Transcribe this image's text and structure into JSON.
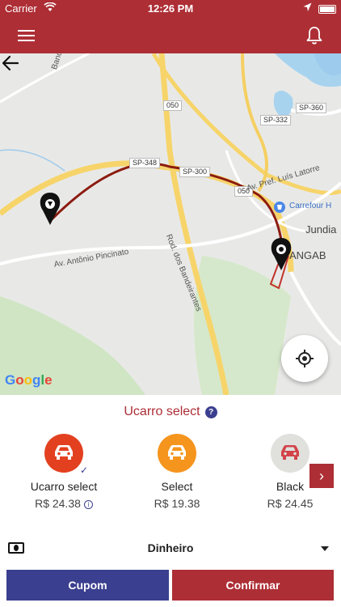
{
  "status_bar": {
    "carrier": "Carrier",
    "time": "12:26 PM"
  },
  "map": {
    "road_labels": [
      "050",
      "SP-360",
      "SP-332",
      "SP-348",
      "SP-300",
      "050"
    ],
    "street_labels": [
      "Bandeirantes",
      "Av. Antônio Pincinato",
      "Rod. dos Bandeirantes",
      "Av. Pref. Luís Latorre"
    ],
    "poi_label": "Carrefour H",
    "city_labels": [
      "Jundia",
      "ANGAB"
    ],
    "google": [
      "G",
      "o",
      "o",
      "g",
      "l",
      "e"
    ]
  },
  "selected_title": "Ucarro select",
  "help_icon": "?",
  "car_options": [
    {
      "name": "Ucarro select",
      "price": "R$ 24.38",
      "color": "#e3401f",
      "selected": true,
      "info": "i"
    },
    {
      "name": "Select",
      "price": "R$ 19.38",
      "color": "#f5951e",
      "selected": false
    },
    {
      "name": "Black",
      "price": "R$ 24.45",
      "color": "#e0e0dc",
      "selected": false
    }
  ],
  "check_icon": "✓",
  "next_icon": "›",
  "payment_method": "Dinheiro",
  "buttons": {
    "coupon": "Cupom",
    "confirm": "Confirmar"
  },
  "colors": {
    "primary": "#ad2e35",
    "secondary": "#3b3f8f"
  }
}
